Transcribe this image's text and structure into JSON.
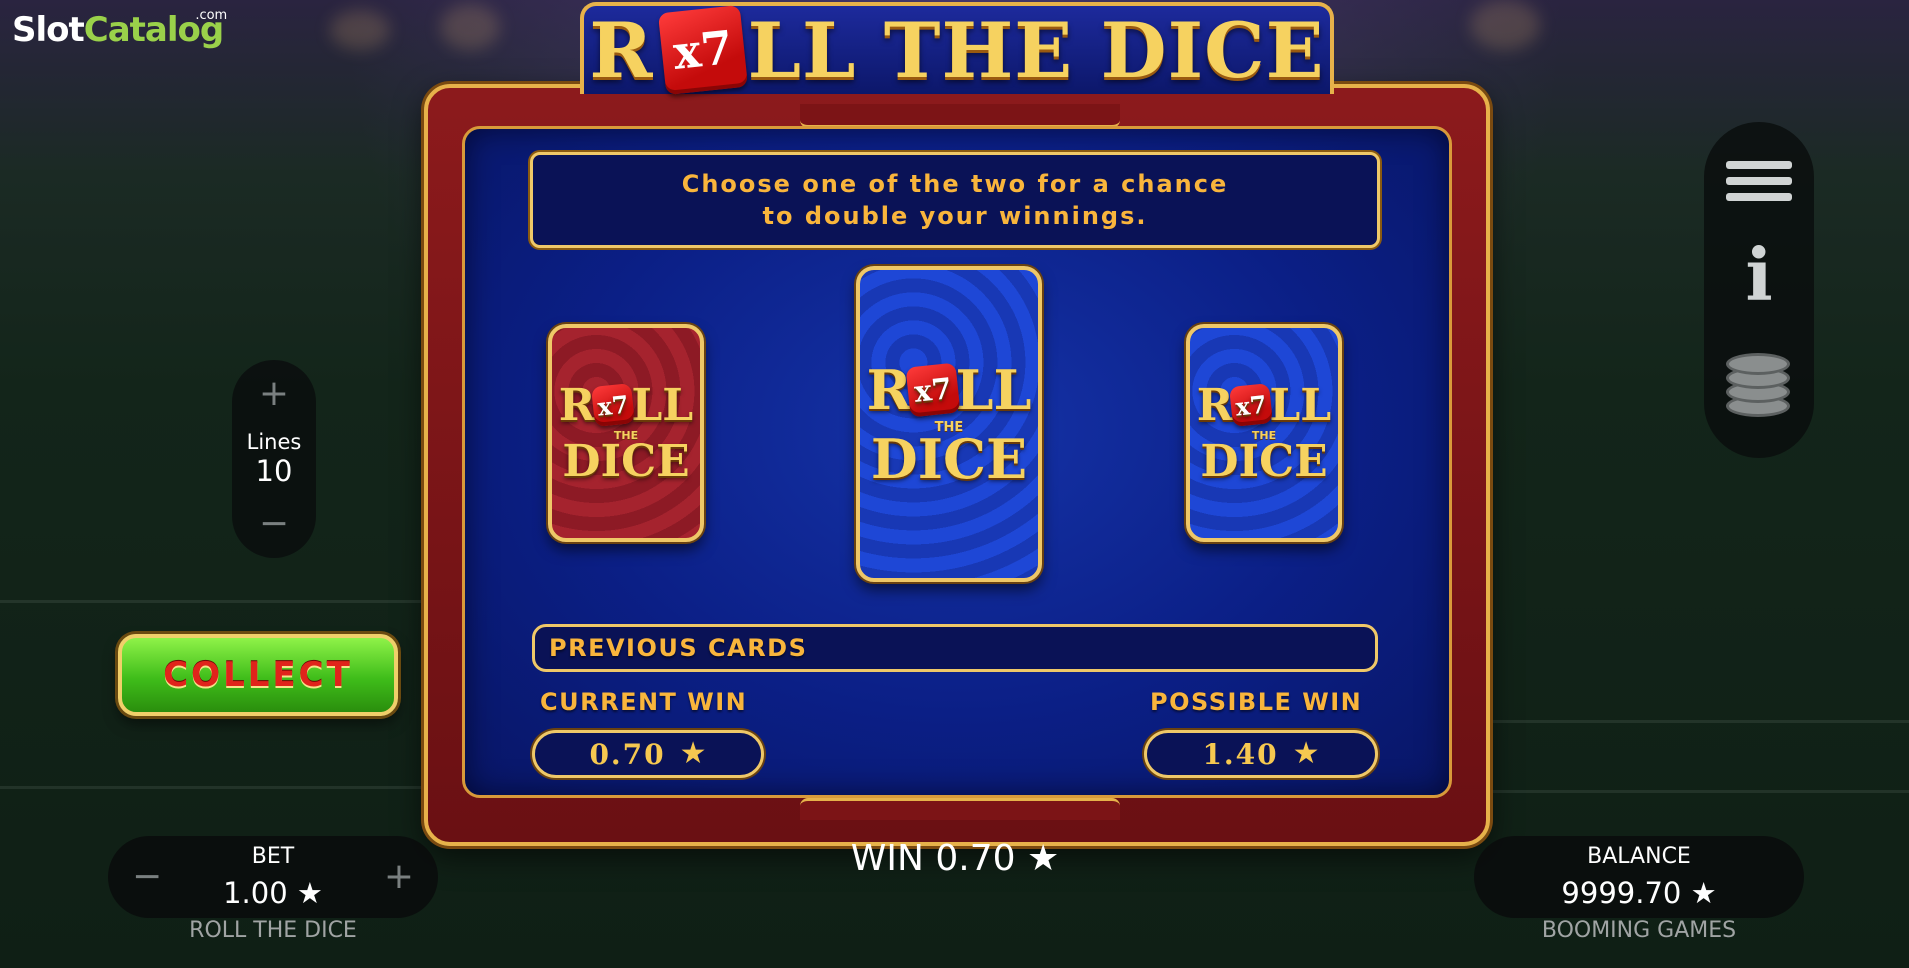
{
  "site_logo": {
    "part1": "Slot",
    "part2": "Catalog",
    "suffix": ".com"
  },
  "title": {
    "before": "R",
    "die": "x7",
    "after": "LL THE DICE"
  },
  "message": "Choose one of the two for a chance to double your winnings.",
  "cards": [
    {
      "color": "red",
      "logo_top_left": "R",
      "logo_die": "x7",
      "logo_top_right": "LL",
      "logo_mid": "THE",
      "logo_bottom": "DICE"
    },
    {
      "color": "blue",
      "logo_top_left": "R",
      "logo_die": "x7",
      "logo_top_right": "LL",
      "logo_mid": "THE",
      "logo_bottom": "DICE"
    },
    {
      "color": "blue",
      "logo_top_left": "R",
      "logo_die": "x7",
      "logo_top_right": "LL",
      "logo_mid": "THE",
      "logo_bottom": "DICE"
    }
  ],
  "previous_cards_label": "PREVIOUS CARDS",
  "current_win": {
    "label": "CURRENT WIN",
    "value": "0.70"
  },
  "possible_win": {
    "label": "POSSIBLE WIN",
    "value": "1.40"
  },
  "collect_label": "COLLECT",
  "lines": {
    "plus": "+",
    "label": "Lines",
    "value": "10",
    "minus": "−"
  },
  "bet": {
    "minus": "−",
    "label": "BET",
    "value": "1.00",
    "plus": "+",
    "game_name": "ROLL THE DICE"
  },
  "win": {
    "label": "WIN",
    "value": "0.70"
  },
  "balance": {
    "label": "BALANCE",
    "value": "9999.70",
    "provider": "BOOMING GAMES"
  },
  "icons": {
    "star": "star-icon",
    "menu": "hamburger-menu-icon",
    "info": "info-icon",
    "coins": "coins-icon"
  },
  "colors": {
    "gold": "#efc868",
    "panel_blue": "#0b1f86",
    "frame_red": "#8c1a1c",
    "collect_green": "#3fbd1a",
    "label_orange": "#f9b53c"
  }
}
